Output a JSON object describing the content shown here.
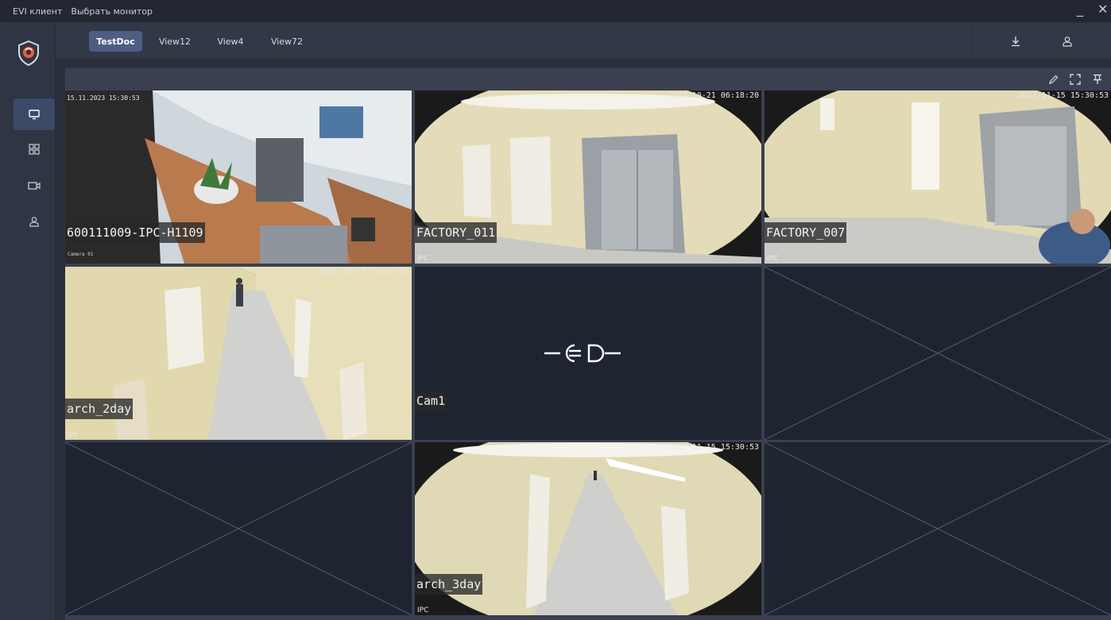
{
  "titlebar": {
    "app": "EVI клиент",
    "menu_monitor": "Выбрать монитор",
    "minimize": "_",
    "close": "✕"
  },
  "sidebar": {
    "items": [
      {
        "name": "monitor",
        "active": true
      },
      {
        "name": "layouts",
        "active": false
      },
      {
        "name": "cameras",
        "active": false
      },
      {
        "name": "users",
        "active": false
      }
    ]
  },
  "tabs": [
    "TestDoc",
    "View12",
    "View4",
    "View72"
  ],
  "active_tab": "TestDoc",
  "grid": {
    "cells": [
      {
        "label": "600111009-IPC-H1109",
        "timestamp": "15.11.2023 15:30:53",
        "subtext": "Camera 01",
        "type": "",
        "state": "video",
        "scene": "office"
      },
      {
        "label": "FACTORY_011",
        "timestamp": "2023-10-21 06:18:20",
        "type": "IPC",
        "state": "video",
        "scene": "elevator-left"
      },
      {
        "label": "FACTORY_007",
        "timestamp": "2023-11-15 15:30:53",
        "type": "IPC",
        "state": "video",
        "scene": "elevator-right"
      },
      {
        "label": "arch_2day",
        "timestamp": "2023-11-15 15:30:53",
        "type": "IPC",
        "state": "video",
        "scene": "corridor"
      },
      {
        "label": "Cam1",
        "timestamp": "",
        "type": "",
        "state": "disconnected"
      },
      {
        "label": "",
        "timestamp": "",
        "type": "",
        "state": "empty"
      },
      {
        "label": "",
        "timestamp": "",
        "type": "",
        "state": "empty"
      },
      {
        "label": "arch_3day",
        "timestamp": "2023-11-15 15:30:53",
        "type": "IPC",
        "state": "video",
        "scene": "long-corridor"
      },
      {
        "label": "",
        "timestamp": "",
        "type": "",
        "state": "empty"
      }
    ]
  },
  "colors": {
    "accent": "#4c5f83",
    "sidebar_active": "#3b4a67",
    "empty_cell": "#1f2431",
    "logo": "#e8623a"
  }
}
